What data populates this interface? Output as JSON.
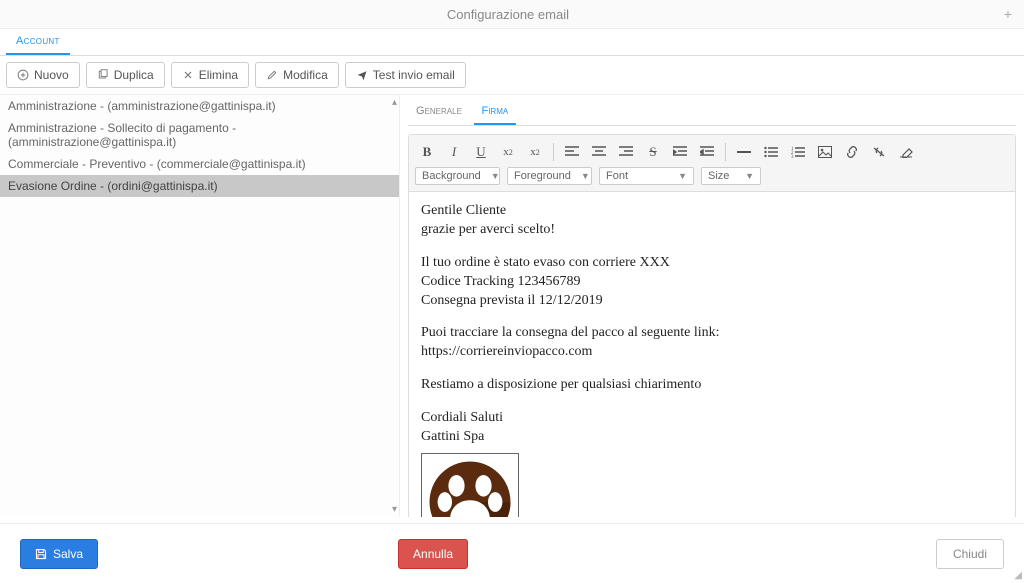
{
  "header": {
    "title": "Configurazione email",
    "plus": "+"
  },
  "mainTab": "Account",
  "toolbar": {
    "nuovo": "Nuovo",
    "duplica": "Duplica",
    "elimina": "Elimina",
    "modifica": "Modifica",
    "test": "Test invio email"
  },
  "list": {
    "items": [
      "Amministrazione - (amministrazione@gattinispa.it)",
      "Amministrazione - Sollecito di pagamento - (amministrazione@gattinispa.it)",
      "Commerciale - Preventivo - (commerciale@gattinispa.it)",
      "Evasione Ordine - (ordini@gattinispa.it)"
    ],
    "selectedIndex": 3
  },
  "subTabs": {
    "generale": "Generale",
    "firma": "Firma"
  },
  "editorSelects": {
    "background": "Background",
    "foreground": "Foreground",
    "font": "Font",
    "size": "Size"
  },
  "signature": {
    "l1": "Gentile Cliente",
    "l2": "grazie per averci scelto!",
    "l3": "Il tuo ordine è stato evaso con corriere XXX",
    "l4": "Codice Tracking 123456789",
    "l5": "Consegna prevista il 12/12/2019",
    "l6": "Puoi tracciare la consegna del pacco al seguente link:",
    "l7": "https://corriereinviopacco.com",
    "l8": "Restiamo a disposizione per qualsiasi chiarimento",
    "l9": "Cordiali Saluti",
    "l10": "Gattini Spa"
  },
  "footer": {
    "salva": "Salva",
    "annulla": "Annulla",
    "chiudi": "Chiudi"
  }
}
